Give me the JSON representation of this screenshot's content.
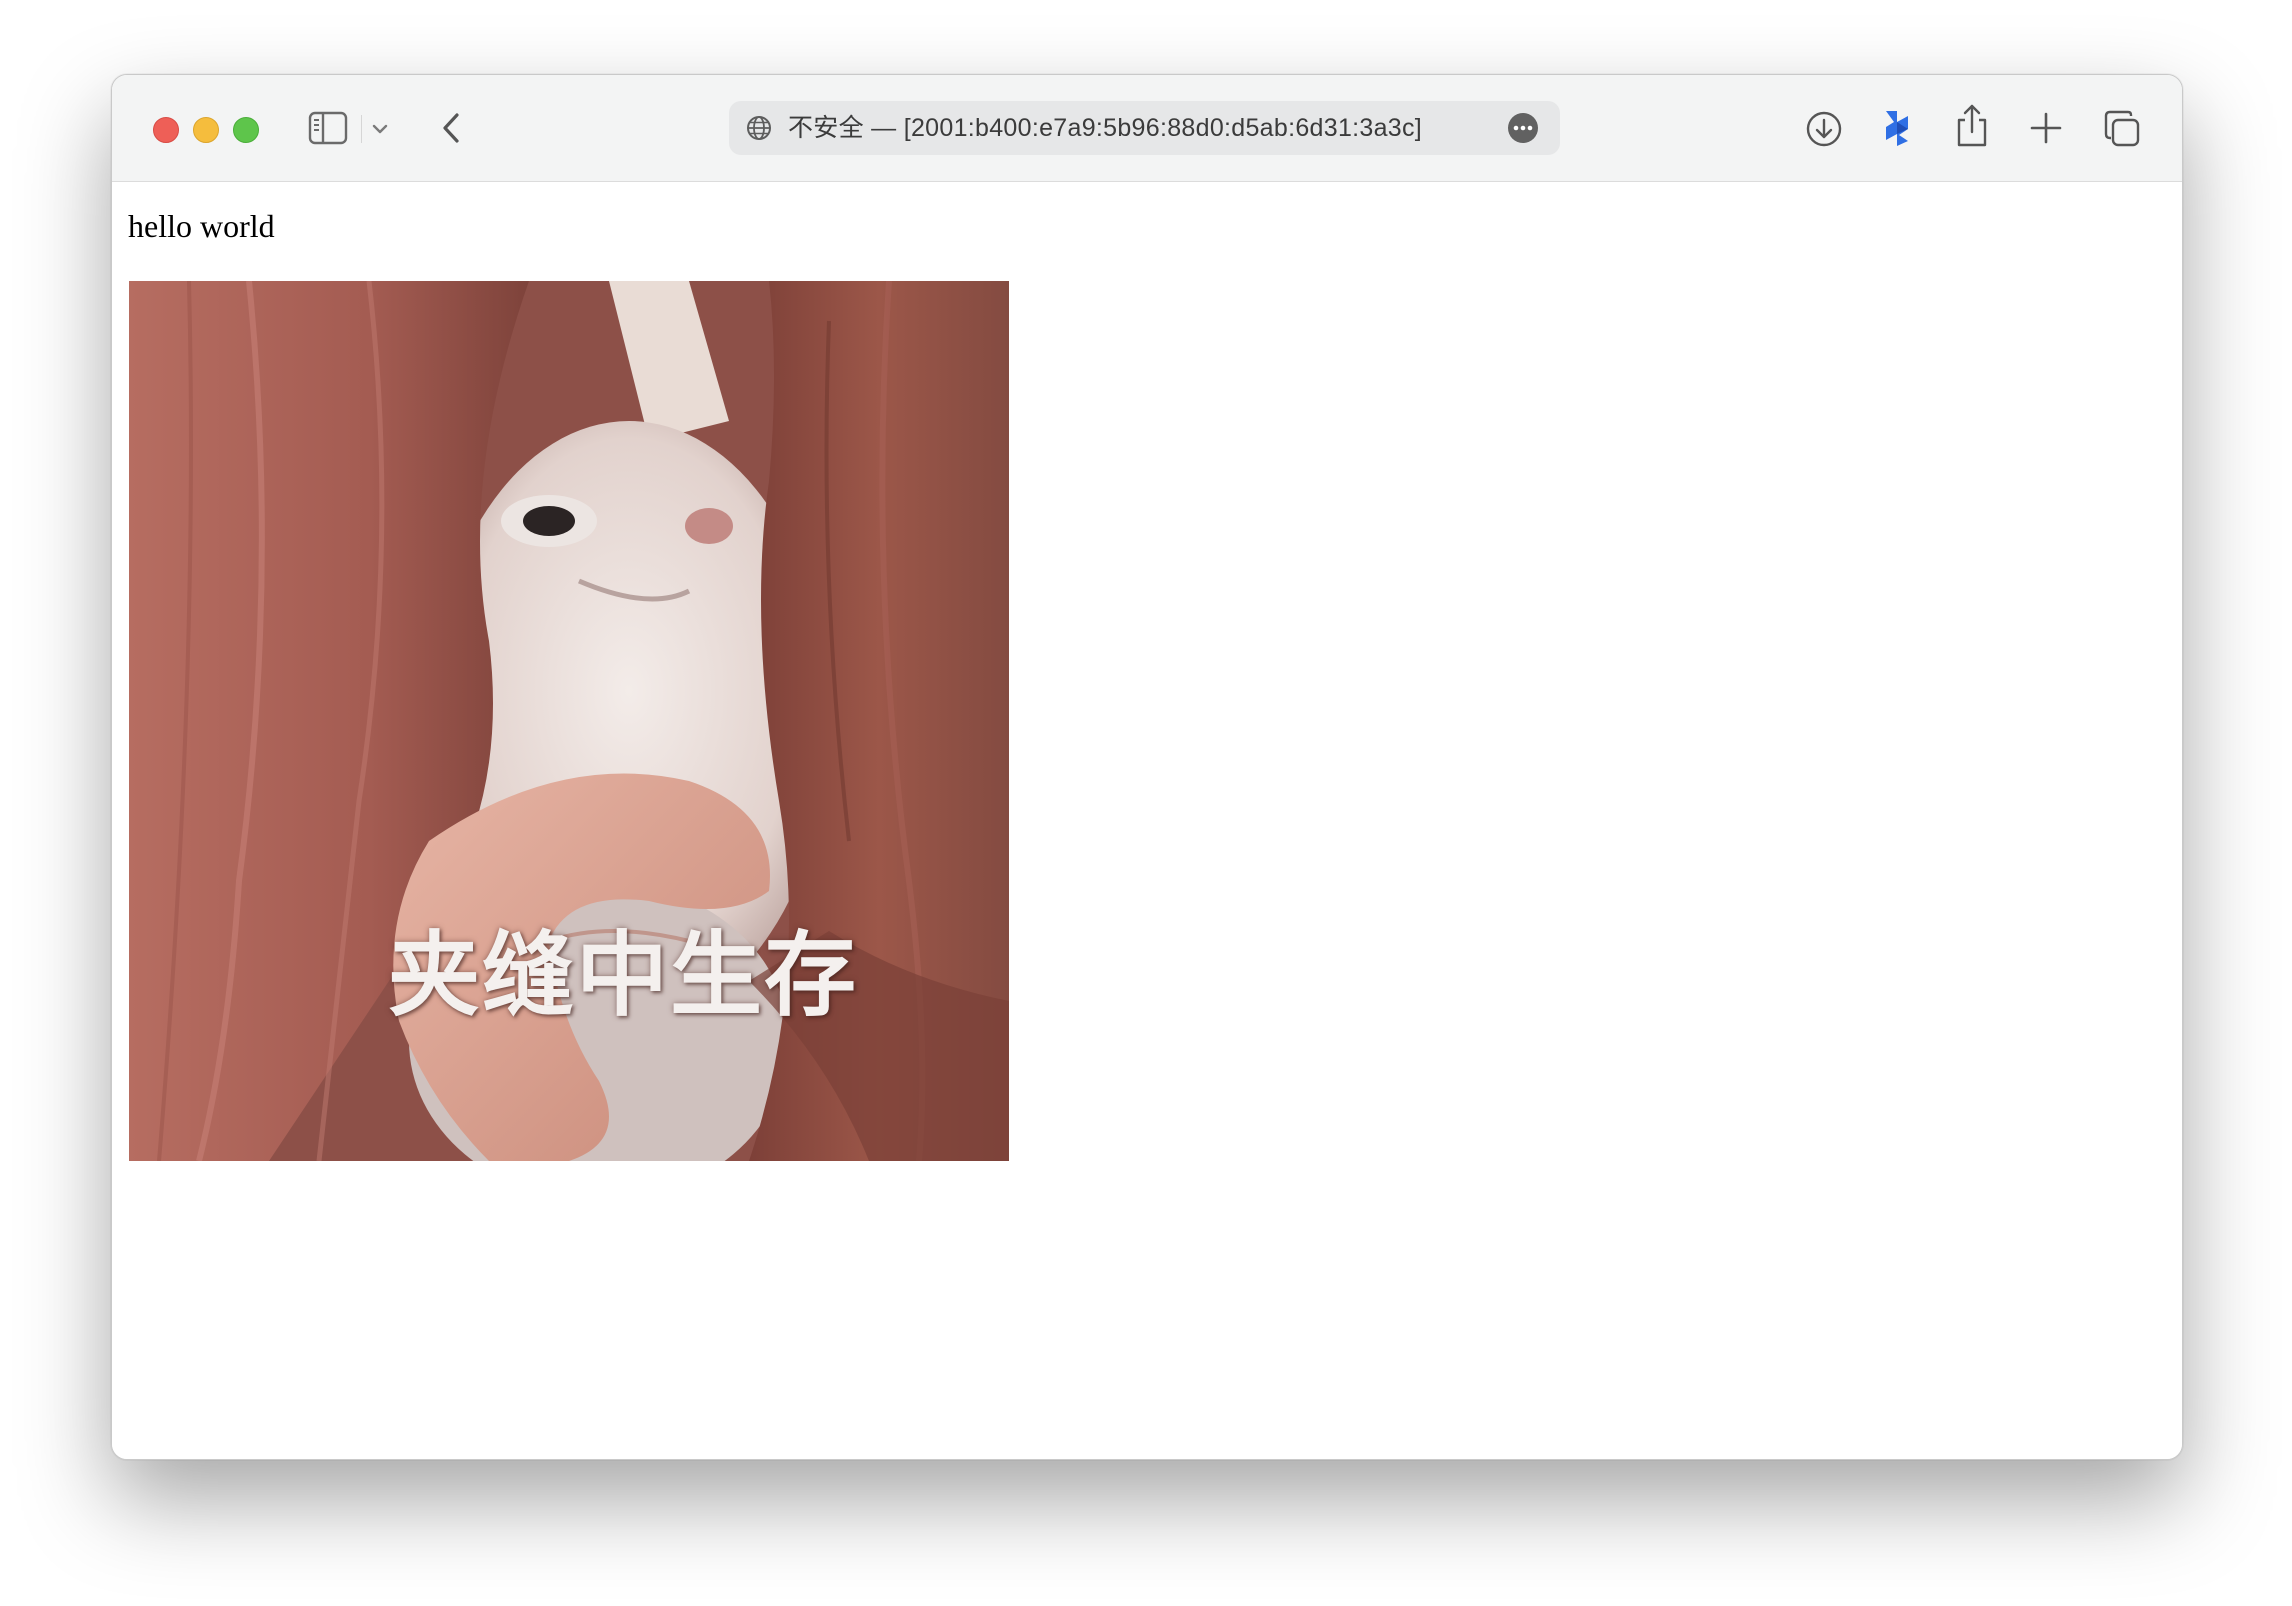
{
  "browser": {
    "address_bar": {
      "security_label": "不安全",
      "separator": "—",
      "url": "[2001:b400:e7a9:5b96:88d0:d5ab:6d31:3a3c]"
    },
    "icons": {
      "close": "close-window-dot",
      "minimize": "minimize-window-dot",
      "maximize": "maximize-window-dot",
      "sidebar": "sidebar-icon",
      "sidebar_menu": "chevron-down-icon",
      "back": "chevron-left-icon",
      "site": "globe-icon",
      "page_menu": "more-icon",
      "download": "download-icon",
      "extension": "extension-icon",
      "share": "share-icon",
      "new_tab": "plus-icon",
      "tab_overview": "tabs-icon"
    }
  },
  "page": {
    "heading": "hello world",
    "image": {
      "caption": "夹缝中生存"
    }
  },
  "colors": {
    "close": "#ee5f57",
    "minimize": "#f5bd3d",
    "maximize": "#5ec54b",
    "extension_blue": "#2f6fe4",
    "toolbar_bg": "#f3f4f4",
    "address_bg": "#e6e7e8"
  }
}
